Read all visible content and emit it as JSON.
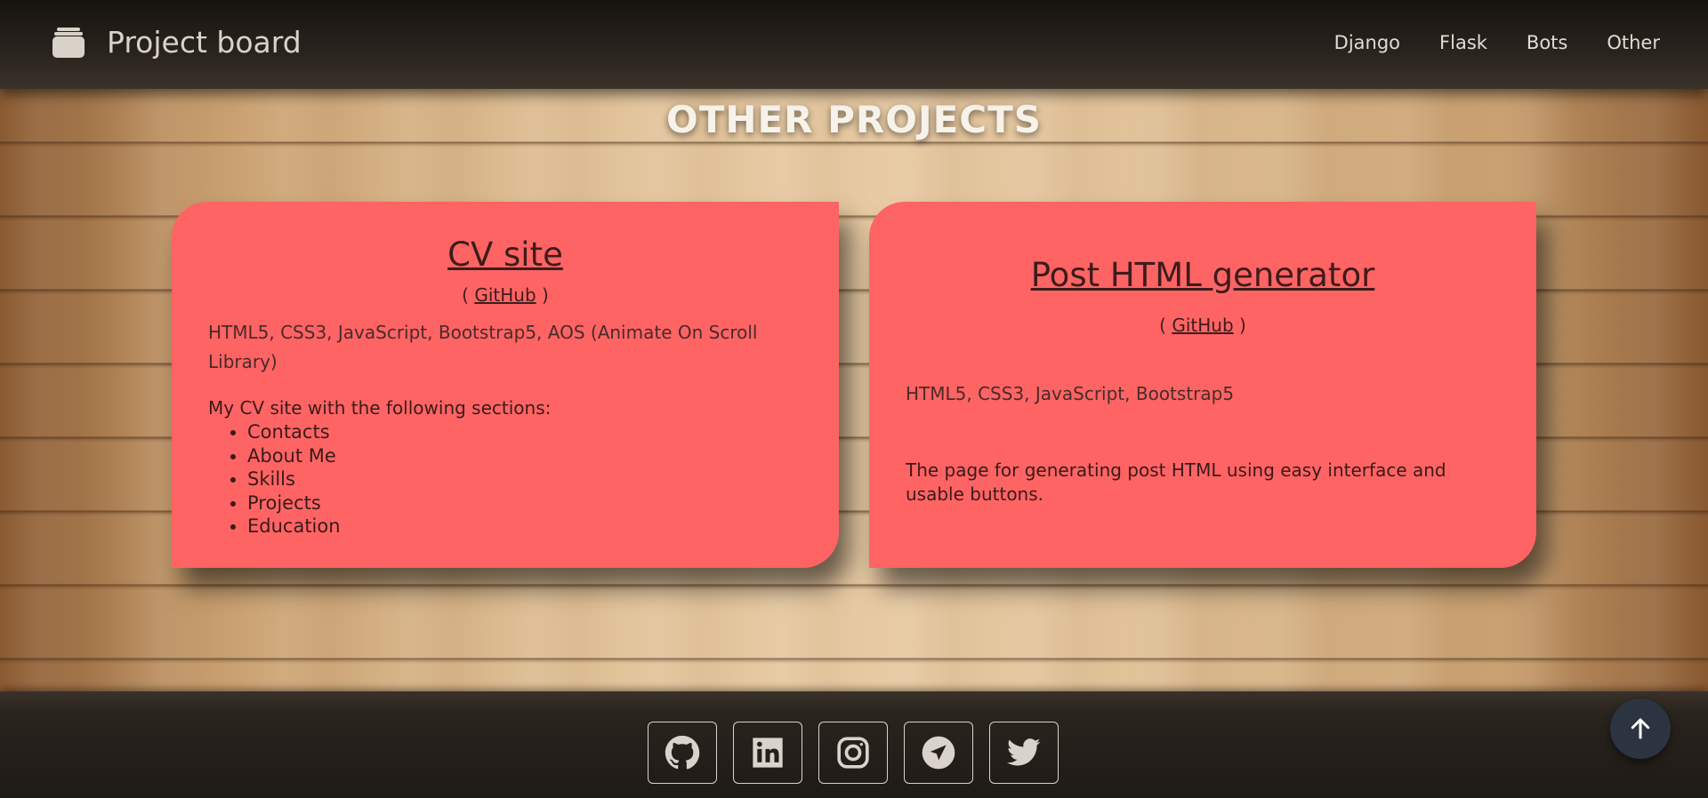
{
  "navbar": {
    "brand_label": "Project board",
    "brand_icon": "stack-icon",
    "links": [
      {
        "label": "Django"
      },
      {
        "label": "Flask"
      },
      {
        "label": "Bots"
      },
      {
        "label": "Other"
      }
    ]
  },
  "page": {
    "title": "OTHER PROJECTS"
  },
  "cards": [
    {
      "title": "CV site",
      "github_prefix": "( ",
      "github_label": "GitHub",
      "github_suffix": " )",
      "tech": "HTML5, CSS3, JavaScript, Bootstrap5, AOS (Animate On Scroll Library)",
      "description": "My CV site with the following sections:",
      "sections": [
        "Contacts",
        "About Me",
        "Skills",
        "Projects",
        "Education"
      ]
    },
    {
      "title": "Post HTML generator",
      "github_prefix": "( ",
      "github_label": "GitHub",
      "github_suffix": " )",
      "tech": "HTML5, CSS3, JavaScript, Bootstrap5",
      "description": "The page for generating post HTML using easy interface and usable buttons."
    }
  ],
  "footer": {
    "social": [
      {
        "icon": "github-icon"
      },
      {
        "icon": "linkedin-icon"
      },
      {
        "icon": "instagram-icon"
      },
      {
        "icon": "telegram-icon"
      },
      {
        "icon": "twitter-icon"
      }
    ]
  },
  "scroll_top": {
    "icon": "arrow-up-icon"
  },
  "colors": {
    "card_bg": "#fe6464",
    "navbar_bg": "#2a241e",
    "scroll_top_bg": "#2b3440"
  }
}
